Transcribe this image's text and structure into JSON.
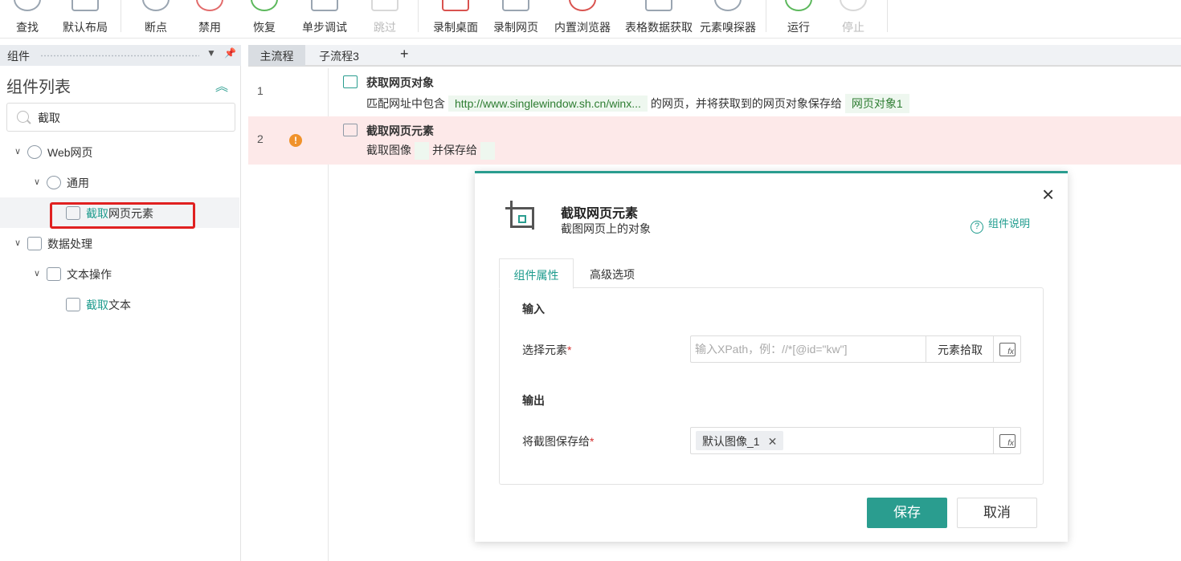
{
  "toolbar": {
    "buttons": [
      {
        "label": "查找",
        "icon": "search-icon",
        "disabled": false
      },
      {
        "label": "默认布局",
        "icon": "layout-icon",
        "disabled": false
      },
      {
        "label": "断点",
        "icon": "breakpoint-icon",
        "disabled": false
      },
      {
        "label": "禁用",
        "icon": "disable-icon",
        "disabled": false
      },
      {
        "label": "恢复",
        "icon": "restore-icon",
        "disabled": false
      },
      {
        "label": "单步调试",
        "icon": "step-debug-icon",
        "disabled": false
      },
      {
        "label": "跳过",
        "icon": "skip-icon",
        "disabled": true
      },
      {
        "label": "录制桌面",
        "icon": "record-desktop-icon",
        "disabled": false
      },
      {
        "label": "录制网页",
        "icon": "record-web-icon",
        "disabled": false
      },
      {
        "label": "内置浏览器",
        "icon": "browser-icon",
        "disabled": false
      },
      {
        "label": "表格数据获取",
        "icon": "table-data-icon",
        "disabled": false
      },
      {
        "label": "元素嗅探器",
        "icon": "sniffer-icon",
        "disabled": false
      },
      {
        "label": "运行",
        "icon": "play-icon",
        "disabled": false
      },
      {
        "label": "停止",
        "icon": "stop-icon",
        "disabled": true
      }
    ]
  },
  "left_panel": {
    "header": "组件",
    "list_title": "组件列表",
    "search": {
      "value": "截取",
      "placeholder": ""
    },
    "tree": [
      {
        "label": "Web网页",
        "highlight": "",
        "icon": "chrome-icon"
      },
      {
        "label": "通用",
        "highlight": "",
        "icon": "link-icon"
      },
      {
        "label": "网页元素",
        "highlight": "截取",
        "icon": "crop-icon"
      },
      {
        "label": "数据处理",
        "highlight": "",
        "icon": "data-process-icon"
      },
      {
        "label": "文本操作",
        "highlight": "",
        "icon": "text-op-icon"
      },
      {
        "label": "文本",
        "highlight": "截取",
        "icon": "crop-text-icon"
      }
    ]
  },
  "editor": {
    "tabs": [
      "主流程",
      "子流程3"
    ],
    "add_tab": "+",
    "steps": [
      {
        "num": "1",
        "title": "获取网页对象",
        "desc_prefix": "匹配网址中包含",
        "url": "http://www.singlewindow.sh.cn/winx...",
        "desc_mid": "的网页，并将获取到的网页对象保存给",
        "var": "网页对象1"
      },
      {
        "num": "2",
        "warn": "!",
        "title": "截取网页元素",
        "desc_prefix": "截取图像",
        "desc_mid": "并保存给"
      }
    ]
  },
  "dialog": {
    "title": "截取网页元素",
    "subtitle": "截图网页上的对象",
    "help": "组件说明",
    "help_icon": "?",
    "close": "×",
    "tabs": {
      "active": "组件属性",
      "inactive": "高级选项"
    },
    "input_section": "输入",
    "output_section": "输出",
    "select_label": "选择元素",
    "select_placeholder": "输入XPath，例：//*[@id=\"kw\"]",
    "pick_button": "元素拾取",
    "save_label": "将截图保存给",
    "required": "*",
    "output_tag": "默认图像_1",
    "tag_remove": "✕",
    "fx": "fx",
    "save_button": "保存",
    "cancel_button": "取消"
  },
  "colors": {
    "accent": "#2a9d8f",
    "error_row": "#fde9e9",
    "highlight_box": "#e02020",
    "warning": "#f0922b"
  }
}
